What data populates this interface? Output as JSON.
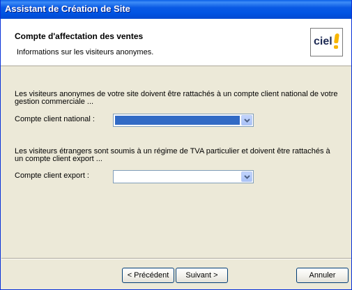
{
  "window": {
    "title": "Assistant de Création de Site"
  },
  "header": {
    "title": "Compte d'affectation des ventes",
    "subtitle": "Informations sur les visiteurs anonymes.",
    "logo_text": "ciel"
  },
  "section_national": {
    "description_line1": "Les visiteurs anonymes de votre site doivent être rattachés à un compte client national de votre",
    "description_line2": "gestion commerciale ...",
    "label": "Compte client national :",
    "value": ""
  },
  "section_export": {
    "description_line1": "Les visiteurs étrangers sont soumis à un régime de TVA particulier et doivent être rattachés à",
    "description_line2": "un compte client export ...",
    "label": "Compte client export :",
    "value": ""
  },
  "buttons": {
    "previous": "< Précédent",
    "next": "Suivant >",
    "cancel": "Annuler"
  },
  "colors": {
    "title_bar": "#0054E3",
    "dialog_background": "#ECE9D8",
    "selection": "#316AC5"
  }
}
